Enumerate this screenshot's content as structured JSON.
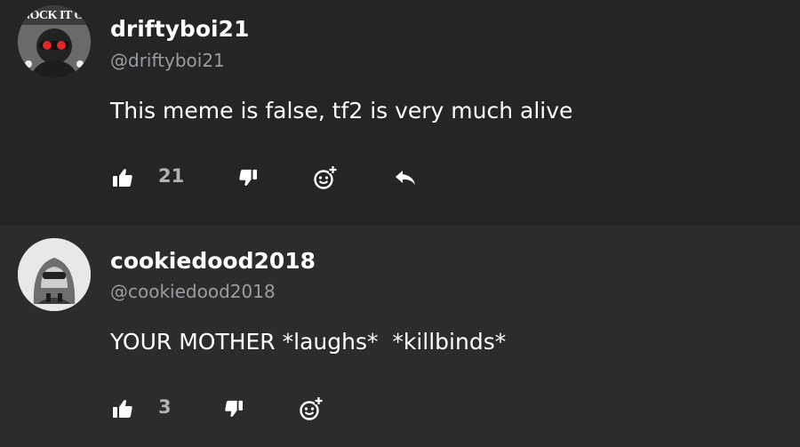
{
  "comments": [
    {
      "username": "driftyboi21",
      "handle": "@driftyboi21",
      "text": "This meme is false, tf2 is very much alive",
      "likes": "21",
      "avatar_banner": "NOCK IT O"
    },
    {
      "username": "cookiedood2018",
      "handle": "@cookiedood2018",
      "text": "YOUR MOTHER *laughs*  *killbinds*",
      "likes": "3"
    }
  ],
  "icons": {
    "like": "thumbs-up-icon",
    "dislike": "thumbs-down-icon",
    "react": "add-reaction-icon",
    "reply": "reply-icon"
  },
  "colors": {
    "background": "#232527",
    "background_alt": "#2a2c2e",
    "text": "#ffffff",
    "muted": "#9a9c9e"
  }
}
